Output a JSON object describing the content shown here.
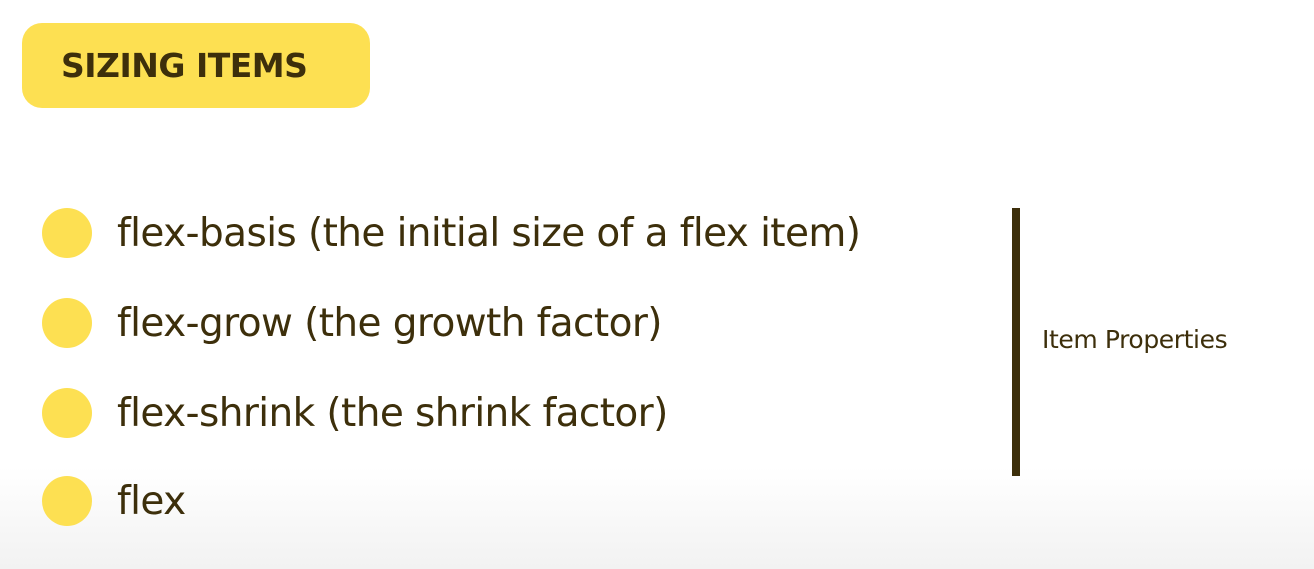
{
  "header": {
    "title": "SIZING ITEMS"
  },
  "list": {
    "items": [
      {
        "label": "flex-basis (the initial size of a flex item)"
      },
      {
        "label": "flex-grow (the growth factor)"
      },
      {
        "label": "flex-shrink (the shrink factor)"
      },
      {
        "label": "flex"
      }
    ]
  },
  "group": {
    "label": "Item Properties"
  },
  "colors": {
    "accent": "#fde052",
    "text": "#3d2f0b"
  }
}
